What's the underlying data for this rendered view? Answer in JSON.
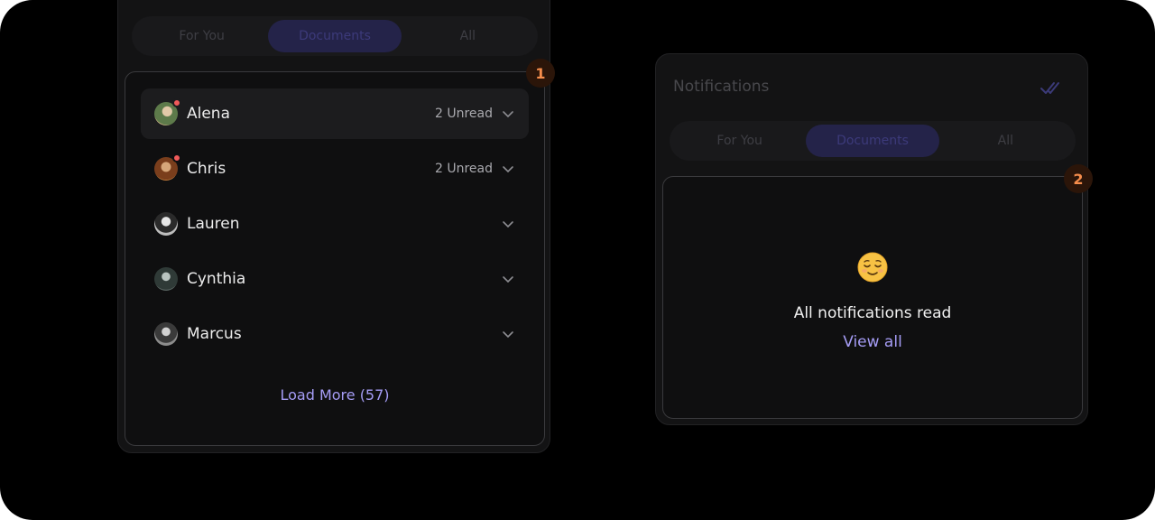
{
  "panel1": {
    "badge": "1",
    "tabs": [
      {
        "label": "For You"
      },
      {
        "label": "Documents",
        "active": true
      },
      {
        "label": "All"
      }
    ],
    "people": [
      {
        "name": "Alena",
        "unread": "2 Unread",
        "online_dot": true,
        "icon": "chevron-down-icon"
      },
      {
        "name": "Chris",
        "unread": "2 Unread",
        "online_dot": true,
        "icon": "chevron-down-icon"
      },
      {
        "name": "Lauren",
        "unread": "",
        "online_dot": false,
        "icon": "chevron-down-icon"
      },
      {
        "name": "Cynthia",
        "unread": "",
        "online_dot": false,
        "icon": "chevron-down-icon"
      },
      {
        "name": "Marcus",
        "unread": "",
        "online_dot": false,
        "icon": "chevron-down-icon"
      }
    ],
    "load_more": "Load More (57)"
  },
  "panel2": {
    "badge": "2",
    "title": "Notifications",
    "mark_read_icon": "double-check-icon",
    "tabs": [
      {
        "label": "For You"
      },
      {
        "label": "Documents",
        "active": true
      },
      {
        "label": "All"
      }
    ],
    "empty_emoji": "relieved-face-icon",
    "empty_text": "All notifications read",
    "view_all": "View all"
  },
  "colors": {
    "accent": "#a59cf5",
    "badge_text": "#f58d4c",
    "unread_dot": "#f05a5a"
  }
}
